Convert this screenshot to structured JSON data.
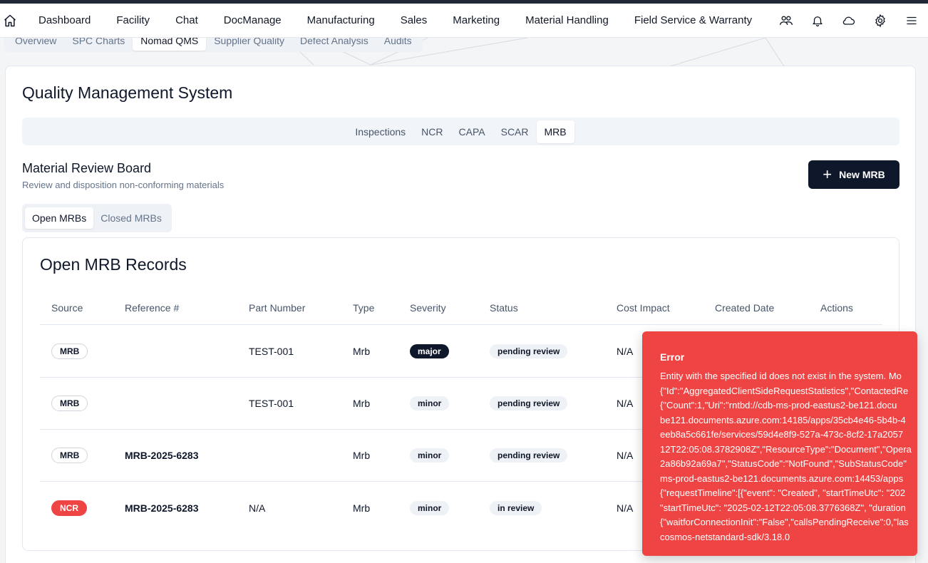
{
  "nav": {
    "items": [
      "Dashboard",
      "Facility",
      "Chat",
      "DocManage",
      "Manufacturing",
      "Sales",
      "Marketing",
      "Material Handling",
      "Field Service & Warranty"
    ]
  },
  "subtabs": {
    "items": [
      "Overview",
      "SPC Charts",
      "Nomad QMS",
      "Supplier Quality",
      "Defect Analysis",
      "Audits"
    ],
    "active": "Nomad QMS"
  },
  "page": {
    "title": "Quality Management System"
  },
  "qms_tabs": {
    "items": [
      "Inspections",
      "NCR",
      "CAPA",
      "SCAR",
      "MRB"
    ],
    "active": "MRB"
  },
  "mrb": {
    "title": "Material Review Board",
    "subtitle": "Review and disposition non-conforming materials",
    "new_button": "New MRB",
    "tabs": [
      "Open MRBs",
      "Closed MRBs"
    ],
    "active_tab": "Open MRBs"
  },
  "records": {
    "title": "Open MRB Records",
    "columns": [
      "Source",
      "Reference #",
      "Part Number",
      "Type",
      "Severity",
      "Status",
      "Cost Impact",
      "Created Date",
      "Actions"
    ],
    "rows": [
      {
        "source": "MRB",
        "reference": "",
        "part": "TEST-001",
        "type": "Mrb",
        "severity": "major",
        "status": "pending review",
        "cost": "N/A"
      },
      {
        "source": "MRB",
        "reference": "",
        "part": "TEST-001",
        "type": "Mrb",
        "severity": "minor",
        "status": "pending review",
        "cost": "N/A"
      },
      {
        "source": "MRB",
        "reference": "MRB-2025-6283",
        "part": "",
        "type": "Mrb",
        "severity": "minor",
        "status": "pending review",
        "cost": "N/A"
      },
      {
        "source": "NCR",
        "reference": "MRB-2025-6283",
        "part": "N/A",
        "type": "Mrb",
        "severity": "minor",
        "status": "in review",
        "cost": "N/A"
      }
    ]
  },
  "toast": {
    "title": "Error",
    "lines": [
      "Entity with the specified id does not exist in the system. Mo",
      "{\"Id\":\"AggregatedClientSideRequestStatistics\",\"ContactedRe",
      "{\"Count\":1,\"Uri\":\"rntbd://cdb-ms-prod-eastus2-be121.docu",
      "be121.documents.azure.com:14185/apps/35cb4e46-5b4b-4",
      "eeb8a5c661fe/services/59d4e8f9-527a-473c-8cf2-17a2057",
      "12T22:05:08.3782908Z\",\"ResourceType\":\"Document\",\"Opera",
      "2a86b92a69a7\",\"StatusCode\":\"NotFound\",\"SubStatusCode\"",
      "ms-prod-eastus2-be121.documents.azure.com:14453/apps",
      "{\"requestTimeline\":[{\"event\": \"Created\", \"startTimeUtc\": \"202",
      "\"startTimeUtc\": \"2025-02-12T22:05:08.3776368Z\", \"duration",
      "{\"waitforConnectionInit\":\"False\",\"callsPendingReceive\":0,\"las",
      "cosmos-netstandard-sdk/3.18.0"
    ]
  },
  "colors": {
    "primary": "#0f172a",
    "error": "#ef4444",
    "muted": "#64748b"
  }
}
